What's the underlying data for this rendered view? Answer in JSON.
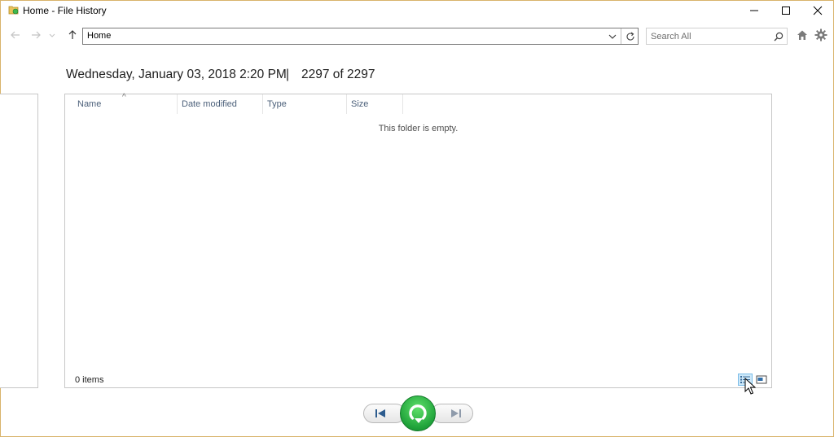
{
  "window": {
    "title": "Home - File History"
  },
  "navbar": {
    "address": "Home",
    "search_placeholder": "Search All"
  },
  "header": {
    "date": "Wednesday, January 03, 2018 2:20 PM",
    "separator": "|",
    "count": "2297 of 2297"
  },
  "columns": [
    {
      "label": "Name"
    },
    {
      "label": "Date modified"
    },
    {
      "label": "Type"
    },
    {
      "label": "Size"
    }
  ],
  "pane": {
    "empty_message": "This folder is empty.",
    "status": "0 items"
  },
  "icons": {
    "app": "file-history-folder-icon",
    "back": "back-arrow-icon",
    "forward": "forward-arrow-icon",
    "recent": "recent-locations-icon",
    "up": "up-arrow-icon",
    "dropdown": "chevron-down-icon",
    "refresh": "refresh-icon",
    "search": "search-icon",
    "home": "home-icon",
    "settings": "gear-icon",
    "details_view": "details-view-icon",
    "large_icons_view": "large-icons-view-icon",
    "previous": "previous-version-icon",
    "restore": "restore-icon",
    "next": "next-version-icon"
  },
  "colors": {
    "restore_green": "#1fa23a",
    "window_border": "#d9b36b",
    "column_header_text": "#4c607a",
    "selected_view": "#cde8f9"
  }
}
